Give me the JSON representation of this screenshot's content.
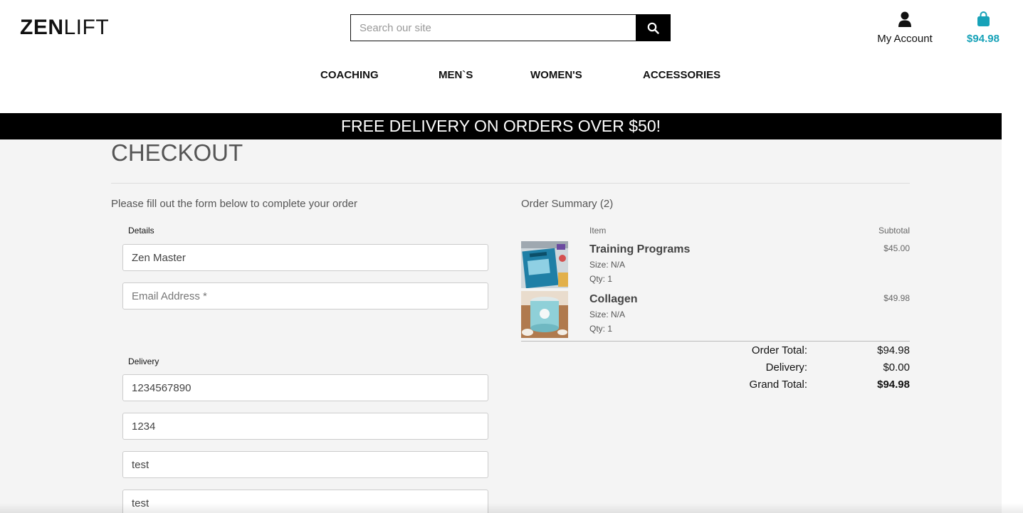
{
  "header": {
    "logo_bold": "ZEN",
    "logo_light": "LIFT",
    "search_placeholder": "Search our site",
    "account_label": "My Account",
    "bag_total": "$94.98"
  },
  "nav": [
    "COACHING",
    "MEN`S",
    "WOMEN'S",
    "ACCESSORIES"
  ],
  "banner": "FREE DELIVERY ON ORDERS OVER $50!",
  "checkout": {
    "title": "CHECKOUT",
    "intro": "Please fill out the form below to complete your order",
    "details_legend": "Details",
    "full_name_value": "Zen Master",
    "email_placeholder": "Email Address *",
    "delivery_legend": "Delivery",
    "delivery_values": [
      "1234567890",
      "1234",
      "test",
      "test"
    ]
  },
  "summary": {
    "title": "Order Summary (2)",
    "col_item": "Item",
    "col_subtotal": "Subtotal",
    "items": [
      {
        "name": "Training Programs",
        "size": "Size: N/A",
        "qty": "Qty: 1",
        "price": "$45.00"
      },
      {
        "name": "Collagen",
        "size": "Size: N/A",
        "qty": "Qty: 1",
        "price": "$49.98"
      }
    ],
    "order_total_label": "Order Total:",
    "order_total": "$94.98",
    "delivery_label": "Delivery:",
    "delivery": "$0.00",
    "grand_total_label": "Grand Total:",
    "grand_total": "$94.98"
  },
  "colors": {
    "accent": "#17a2b8",
    "banner_bg": "#000000",
    "page_bg": "#f4f4f4"
  }
}
